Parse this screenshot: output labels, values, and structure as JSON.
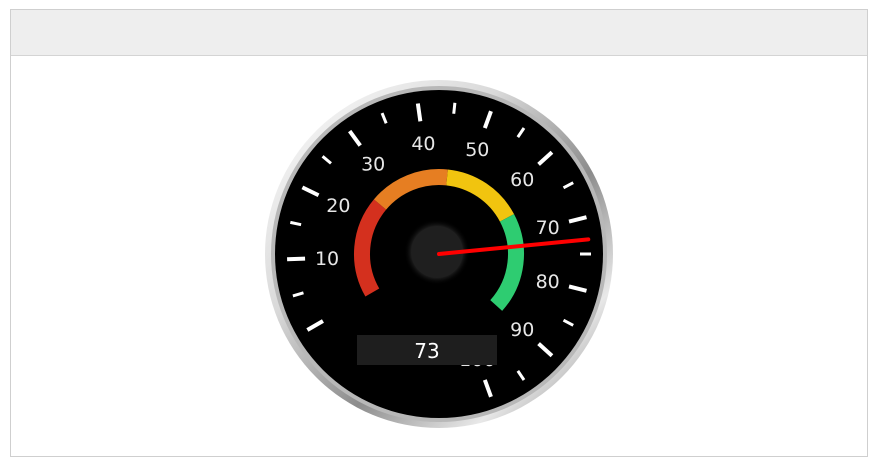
{
  "chart_data": {
    "type": "gauge",
    "min": 0,
    "max": 100,
    "value": 73,
    "value_display": "73",
    "major_ticks": [
      10,
      20,
      30,
      40,
      50,
      60,
      70,
      80,
      90,
      100
    ],
    "tick_labels": [
      "10",
      "20",
      "30",
      "40",
      "50",
      "60",
      "70",
      "80",
      "90",
      "100"
    ],
    "bands": [
      {
        "from": 0,
        "to": 25,
        "color": "#d4301e"
      },
      {
        "from": 25,
        "to": 45,
        "color": "#e67e22"
      },
      {
        "from": 45,
        "to": 65,
        "color": "#f1c40f"
      },
      {
        "from": 65,
        "to": 90,
        "color": "#2ecc71"
      }
    ],
    "needle_color": "#ff0000",
    "face_color": "#000000",
    "tick_color": "#ffffff"
  }
}
